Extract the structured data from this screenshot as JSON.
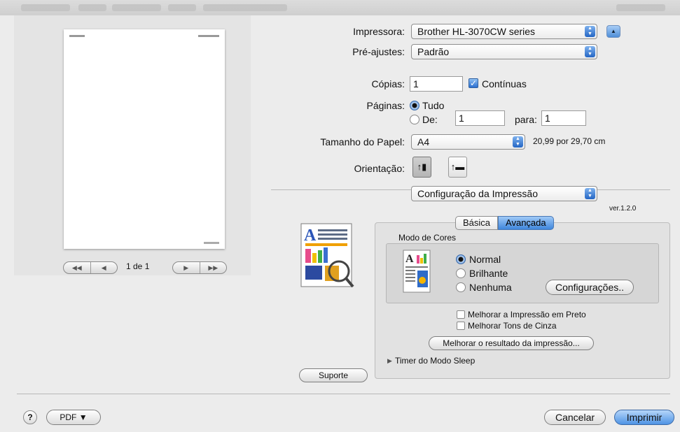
{
  "colors": {
    "accent": "#3f86dc",
    "panel": "#e2e2e2",
    "page_bg": "#ececec"
  },
  "printer": {
    "label": "Impressora:",
    "value": "Brother HL-3070CW series"
  },
  "presets": {
    "label": "Pré-ajustes:",
    "value": "Padrão"
  },
  "copies": {
    "label": "Cópias:",
    "value": "1",
    "collated_label": "Contínuas",
    "collated_checked": true
  },
  "pages": {
    "label": "Páginas:",
    "all_label": "Tudo",
    "from_label": "De:",
    "from_value": "1",
    "to_label": "para:",
    "to_value": "1"
  },
  "paper_size": {
    "label": "Tamanho do Papel:",
    "value": "A4",
    "dims": "20,99 por 29,70 cm"
  },
  "orientation": {
    "label": "Orientação:",
    "options": [
      "portrait-icon",
      "landscape-icon"
    ],
    "selected": "portrait-icon"
  },
  "section": {
    "value": "Configuração da Impressão",
    "version": "ver.1.2.0"
  },
  "tabs": {
    "basic": "Básica",
    "advanced": "Avançada",
    "selected": "advanced"
  },
  "color_mode": {
    "title": "Modo de Cores",
    "options": [
      "Normal",
      "Brilhante",
      "Nenhuma"
    ],
    "selected": "Normal",
    "settings_button": "Configurações.."
  },
  "improve_black": "Melhorar a Impressão em Preto",
  "improve_gray": "Melhorar Tons de Cinza",
  "improve_result_button": "Melhorar o resultado da impressão...",
  "sleep_timer": "Timer do Modo Sleep",
  "support_button": "Suporte",
  "preview": {
    "page_counter": "1 de 1",
    "nav_first": "◀◀",
    "nav_prev": "◀",
    "nav_next": "▶",
    "nav_last": "▶▶"
  },
  "footer": {
    "help": "?",
    "pdf": "PDF ▼",
    "cancel": "Cancelar",
    "print": "Imprimir"
  }
}
